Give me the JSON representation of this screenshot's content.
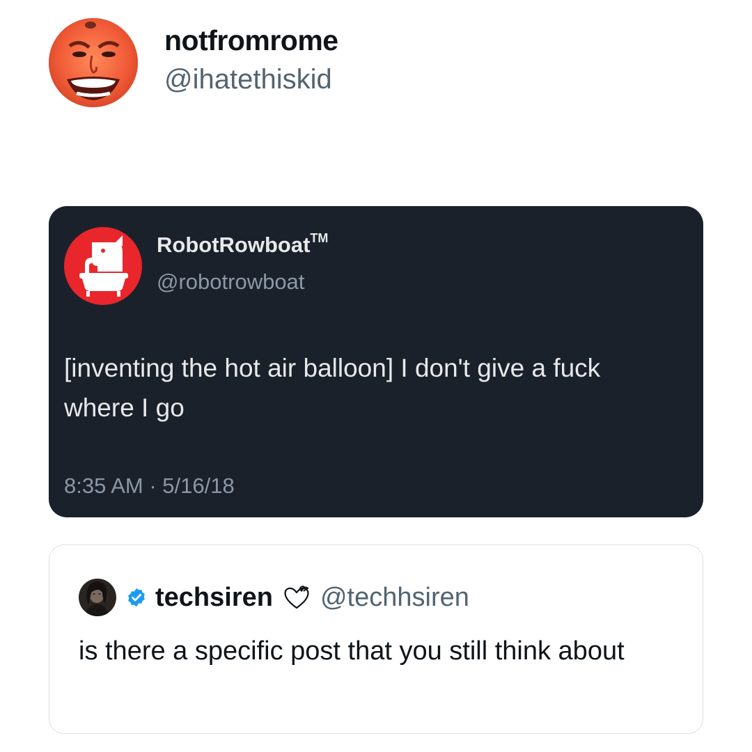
{
  "post": {
    "display_name": "notfromrome",
    "handle": "@ihatethiskid",
    "avatar_icon": "laughing-face-avatar"
  },
  "quoted_tweet": {
    "display_name": "RobotRowboat",
    "trademark": "TM",
    "handle": "@robotrowboat",
    "avatar_icon": "elephant-in-bathtub-logo",
    "brand_color": "#e8262c",
    "text": "[inventing the hot air balloon] I don't give a fuck where I go",
    "timestamp": "8:35 AM · 5/16/18",
    "background_color": "#1b212b"
  },
  "reply": {
    "display_name": "techsiren",
    "handle": "@techhsiren",
    "verified": true,
    "verified_color": "#1d9bf0",
    "name_emoji": "heart-with-ribbon",
    "avatar_icon": "dark-portrait-avatar",
    "text": "is there a specific post that you still think about"
  }
}
